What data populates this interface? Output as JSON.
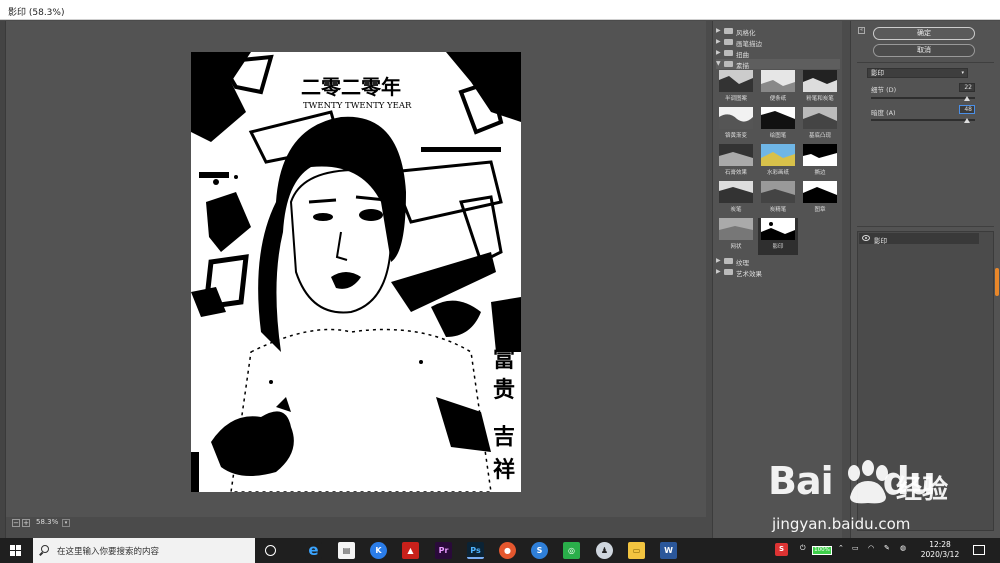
{
  "window": {
    "title": "影印 (58.3%)"
  },
  "zoom": {
    "value": "58.3%",
    "minus": "−",
    "plus": "+"
  },
  "preview": {
    "title_cn": "二零二零年",
    "title_en": "TWENTY TWENTY YEAR",
    "side_text": [
      "富",
      "贵",
      "吉",
      "祥"
    ]
  },
  "gallery": {
    "groups": [
      {
        "label": "风格化",
        "open": false
      },
      {
        "label": "画笔描边",
        "open": false
      },
      {
        "label": "扭曲",
        "open": false
      },
      {
        "label": "素描",
        "open": true
      }
    ],
    "thumbs": [
      {
        "label": "半调图案"
      },
      {
        "label": "便条纸"
      },
      {
        "label": "粉笔和炭笔"
      },
      {
        "label": "铬黄渐变"
      },
      {
        "label": "绘图笔"
      },
      {
        "label": "基底凸现"
      },
      {
        "label": "石膏效果"
      },
      {
        "label": "水彩画纸"
      },
      {
        "label": "撕边"
      },
      {
        "label": "炭笔"
      },
      {
        "label": "炭精笔"
      },
      {
        "label": "图章"
      },
      {
        "label": "网状"
      },
      {
        "label": "影印",
        "selected": true
      }
    ],
    "after_groups": [
      {
        "label": "纹理"
      },
      {
        "label": "艺术效果"
      }
    ]
  },
  "settings": {
    "collapse_glyph": "«",
    "ok_label": "确定",
    "cancel_label": "取消",
    "filter_select": "影印",
    "params": [
      {
        "label": "细节 (D)",
        "value": "22",
        "fraction": 0.92
      },
      {
        "label": "暗度 (A)",
        "value": "48",
        "fraction": 0.92
      }
    ],
    "layer_item": "影印"
  },
  "taskbar": {
    "search_placeholder": "在这里输入你要搜索的内容",
    "apps": [
      "edge-icon",
      "store-icon",
      "kugou-icon",
      "acrobat-icon",
      "premiere-icon",
      "photoshop-icon",
      "firefox-icon",
      "sogou-icon",
      "wechat-icon",
      "qq-icon",
      "explorer-icon",
      "word-icon"
    ],
    "battery": "100%",
    "time": "12:28",
    "date": "2020/3/12"
  },
  "watermark": {
    "logo": "Bai",
    "logo_tail": "du",
    "cn": "经验",
    "url": "jingyan.baidu.com"
  },
  "colors": {
    "accent": "#e8872a",
    "focus": "#4a8fe8",
    "panel": "#535353",
    "taskbar": "#1f1f1f"
  }
}
